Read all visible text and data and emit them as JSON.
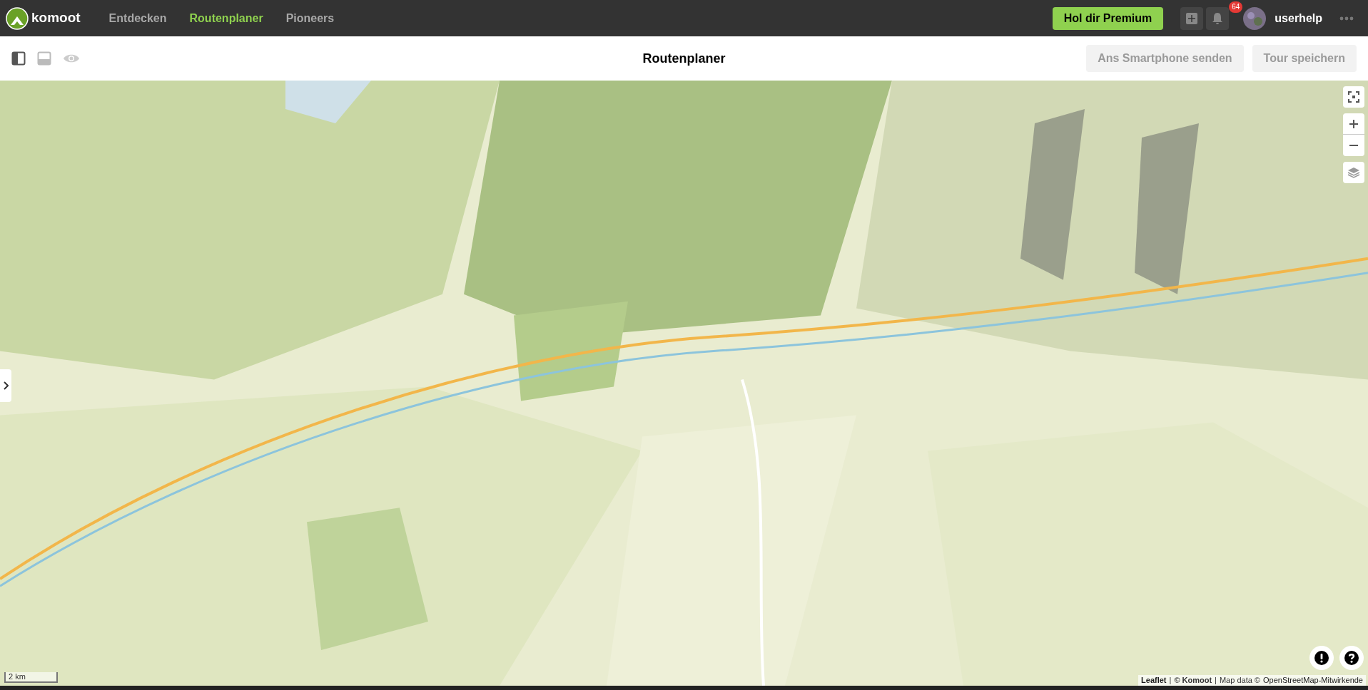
{
  "header": {
    "brand": "komoot",
    "nav": [
      {
        "label": "Entdecken",
        "selected": false
      },
      {
        "label": "Routenplaner",
        "selected": true
      },
      {
        "label": "Pioneers",
        "selected": false
      }
    ],
    "premium_button": "Hol dir Premium",
    "notification_count": "64",
    "username": "userhelp"
  },
  "toolbar": {
    "title": "Routenplaner",
    "buttons": [
      {
        "label": "Ans Smartphone senden",
        "disabled": true
      },
      {
        "label": "Tour speichern",
        "disabled": true
      }
    ]
  },
  "map": {
    "kind": "picture",
    "scale": "2 km",
    "attribution": {
      "leaflet": "Leaflet",
      "separator_1": "|",
      "komoot": "© Komoot",
      "separator_2": "|",
      "data_prefix": "Map data ©",
      "osm": "OpenStreetMap-Mitwirkende"
    }
  }
}
